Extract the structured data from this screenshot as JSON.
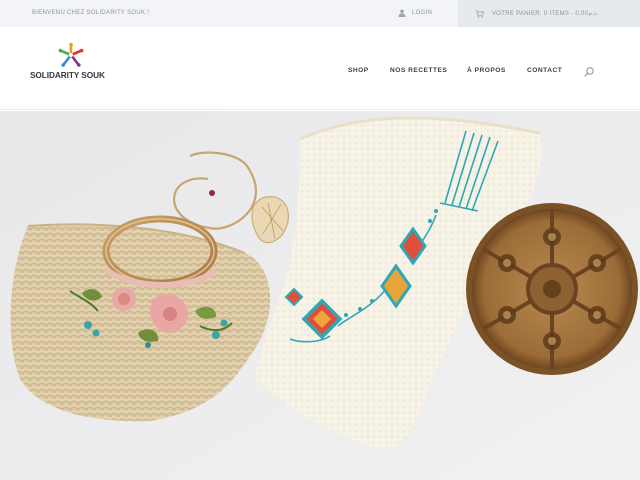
{
  "topbar": {
    "welcome": "BIENVENU CHEZ SOLIDARITY SOUK !",
    "login_label": "LOGIN",
    "cart_label": "VOTRE PANIER: 0 ITEMS - 0,00د.م."
  },
  "brand": {
    "name": "SOLIDARITY SOUK"
  },
  "nav": {
    "items": [
      "SHOP",
      "NOS RECETTES",
      "À PROPOS",
      "CONTACT"
    ]
  },
  "icons": {
    "login": "user-icon",
    "cart": "cart-icon",
    "search": "search-icon",
    "logo": "star-people-logo"
  },
  "colors": {
    "topbar_bg": "#f2f4f7",
    "cart_bg": "#e6e9ed",
    "muted_text": "#8d939a",
    "nav_text": "#3a4048"
  }
}
